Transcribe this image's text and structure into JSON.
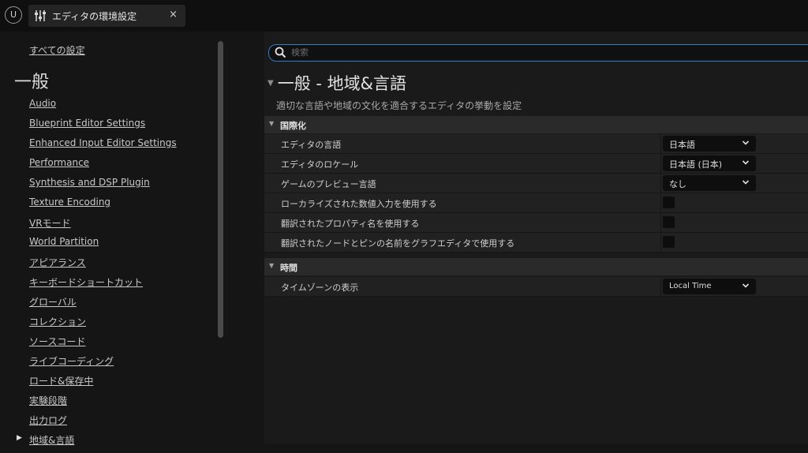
{
  "titlebar": {
    "logo_icon": "unreal-engine-logo",
    "tab_icon": "settings-sliders-icon",
    "tab_title": "エディタの環境設定",
    "close_glyph": "×"
  },
  "sidebar": {
    "all_settings": "すべての設定",
    "heading": "一般",
    "items": [
      "Audio",
      "Blueprint Editor Settings",
      "Enhanced Input Editor Settings",
      "Performance",
      "Synthesis and DSP Plugin",
      "Texture Encoding",
      "VRモード",
      "World Partition",
      "アピアランス",
      "キーボードショートカット",
      "グローバル",
      "コレクション",
      "ソースコード",
      "ライブコーディング",
      "ロード&保存中",
      "実験段階",
      "出力ログ",
      "地域&言語"
    ],
    "active_item": "地域&言語"
  },
  "search": {
    "placeholder": "検索",
    "value": ""
  },
  "main": {
    "title": "一般 - 地域&言語",
    "description": "適切な言語や地域の文化を適合するエディタの挙動を設定",
    "sections": [
      {
        "label": "国際化",
        "rows": [
          {
            "label": "エディタの言語",
            "type": "dropdown",
            "value": "日本語"
          },
          {
            "label": "エディタのロケール",
            "type": "dropdown",
            "value": "日本語 (日本)"
          },
          {
            "label": "ゲームのプレビュー言語",
            "type": "dropdown",
            "value": "なし"
          },
          {
            "label": "ローカライズされた数値入力を使用する",
            "type": "checkbox",
            "checked": false
          },
          {
            "label": "翻訳されたプロパティ名を使用する",
            "type": "checkbox",
            "checked": false
          },
          {
            "label": "翻訳されたノードとピンの名前をグラフエディタで使用する",
            "type": "checkbox",
            "checked": false
          }
        ]
      },
      {
        "label": "時間",
        "rows": [
          {
            "label": "タイムゾーンの表示",
            "type": "dropdown",
            "value": "Local Time"
          }
        ]
      }
    ]
  },
  "colors": {
    "accent": "#2f7ec8",
    "background": "#151515",
    "panel": "#1a1a1a",
    "row": "#212121",
    "section": "#2a2a2a"
  }
}
